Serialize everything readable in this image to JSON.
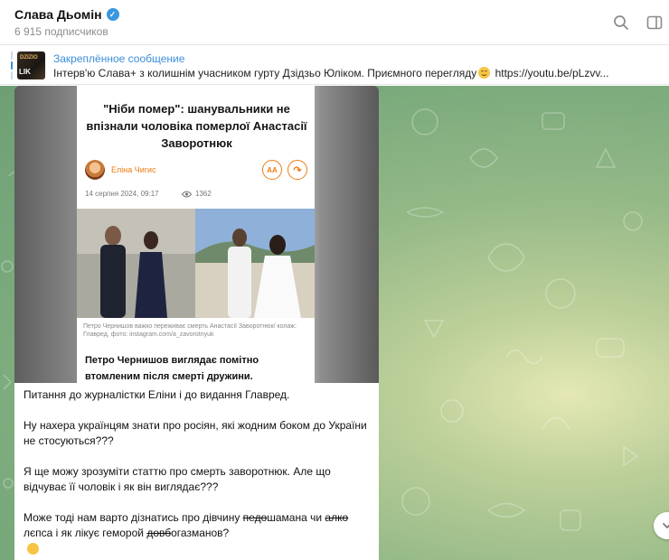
{
  "channel": {
    "title": "Слава Дьомін",
    "subscribers": "6 915 подписчиков"
  },
  "header_icons": {
    "search": "search-icon",
    "sidebar": "sidebar-toggle-icon",
    "verified": "verified-badge-icon"
  },
  "pinned": {
    "label": "Закреплённое сообщение",
    "thumb_top": "DZIZIO",
    "thumb_bottom": "LIK",
    "text_before_emoji": "Інтерв'ю Слава+ з колишнім учасником гурту Дзідзьо Юліком. Приємного перегляду",
    "text_after_emoji": " https://youtu.be/pLzvv..."
  },
  "article": {
    "title": "\"Ніби помер\": шанувальники не впізнали чоловіка померлої Анастасії Заворотнюк",
    "author": "Еліна Чигис",
    "font_button": "АА",
    "share_button": "↷",
    "date": "14 серпня 2024, 09:17",
    "views": "1362",
    "caption": "Петро Чернишов важко переживає смерть Анастасії Заворотнюк/ колаж: Главред, фото: instagram.com/a_zavorotnyuk",
    "lead": "Петро Чернишов виглядає помітно втомленим після смерті дружини."
  },
  "message": {
    "p1": "Питання до журналістки Еліни і до видання Главред.",
    "p2": "Ну нахера українцям знати про росіян, які жодним боком до України не стосуються???",
    "p3": "Я ще можу зрозуміти статтю про смерть заворотнюк. Але що відчуває її чоловік і як він виглядає???",
    "p4_a": "Може тоді нам варто дізнатись про дівчину ",
    "p4_strike1": "педо",
    "p4_b": "шамана чи ",
    "p4_strike2": "алко",
    "p4_c": " лєпса і як лікує геморой ",
    "p4_strike3": "довб",
    "p4_d": "огазманов?"
  },
  "colors": {
    "accent": "#3a8fd9",
    "article_accent": "#f07b12",
    "chat_bg": "#8fb784"
  }
}
